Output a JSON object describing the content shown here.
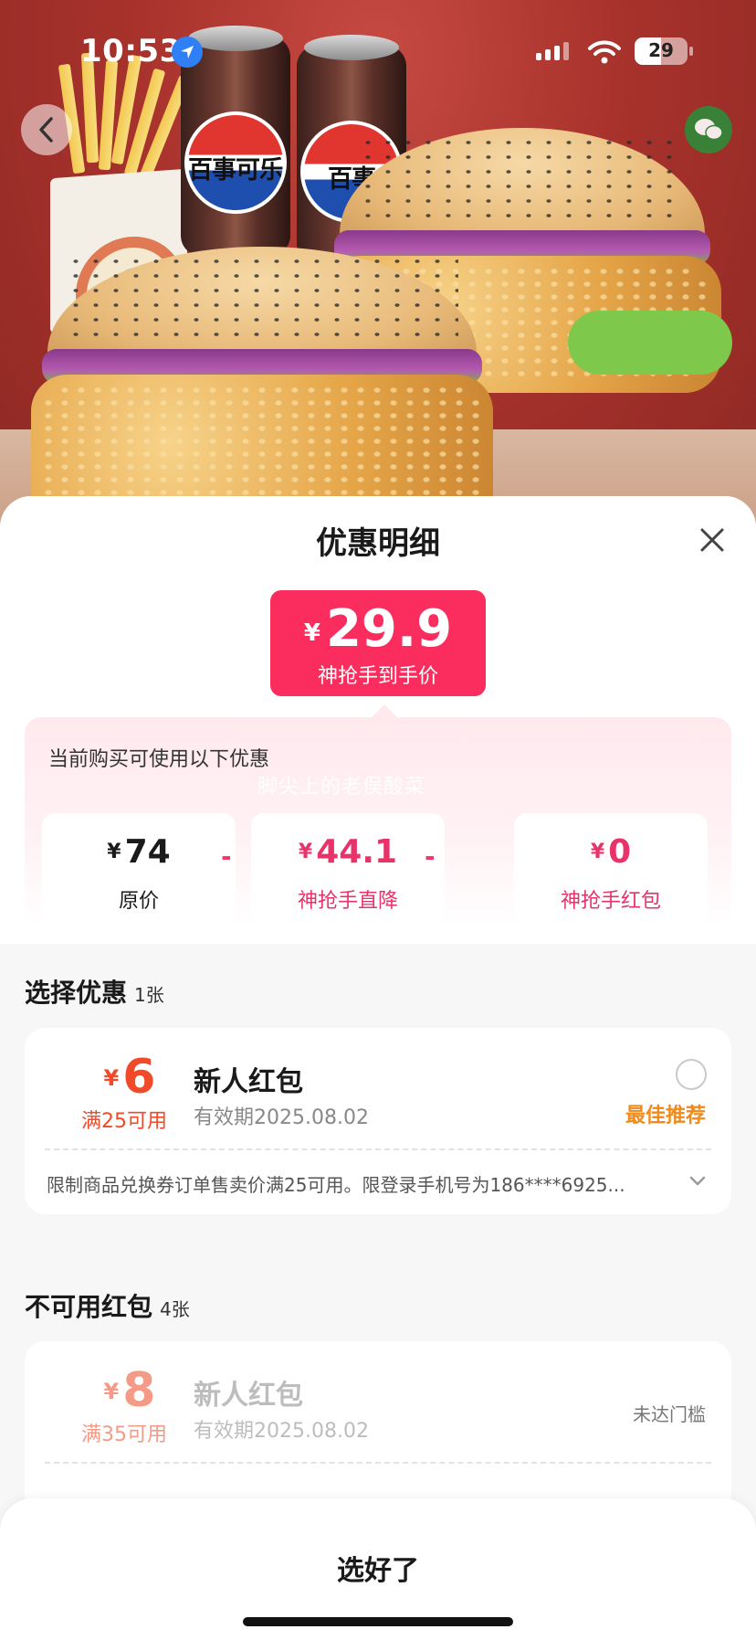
{
  "status_bar": {
    "time": "10:53",
    "battery": "29"
  },
  "hero": {
    "can_text": "百事可乐",
    "can_text_partial": "百事"
  },
  "sheet": {
    "title": "优惠明细",
    "price": {
      "currency": "¥",
      "amount": "29.9",
      "label": "神抢手到手价"
    },
    "discount": {
      "hint": "当前购买可使用以下优惠",
      "watermark": "脚尖上的老俣酸菜",
      "items": [
        {
          "currency": "¥",
          "value": "74",
          "label": "原价"
        },
        {
          "currency": "¥",
          "value": "44.1",
          "label": "神抢手直降"
        },
        {
          "currency": "¥",
          "value": "0",
          "label": "神抢手红包"
        }
      ],
      "operator": "-"
    },
    "select_section": {
      "title": "选择优惠",
      "count": "1张"
    },
    "available_coupon": {
      "currency": "¥",
      "amount": "6",
      "condition": "满25可用",
      "name": "新人红包",
      "validity": "有效期2025.08.02",
      "tag": "最佳推荐",
      "description": "限制商品兑换券订单售卖价满25可用。限登录手机号为186****6925..."
    },
    "unavailable_section": {
      "title": "不可用红包",
      "count": "4张"
    },
    "unavailable_coupon": {
      "currency": "¥",
      "amount": "8",
      "condition": "满35可用",
      "name": "新人红包",
      "validity": "有效期2025.08.02",
      "status": "未达门槛"
    },
    "confirm_label": "选好了"
  },
  "colors": {
    "accent": "#fb2d5f",
    "pink_text": "#e8336a",
    "coupon_red": "#f04a2a",
    "recommend_orange": "#f08a1c"
  }
}
